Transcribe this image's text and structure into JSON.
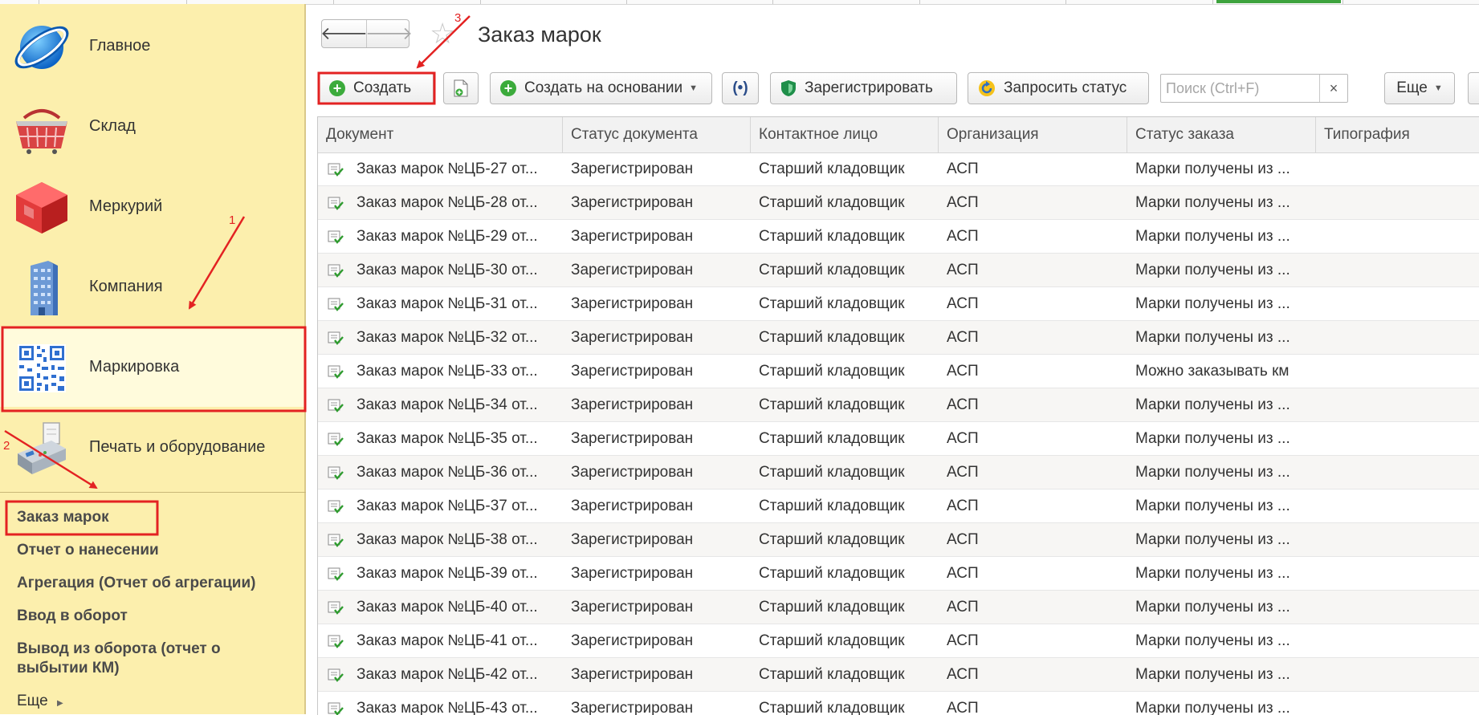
{
  "sidebar": {
    "sections": [
      {
        "label": "Главное",
        "icon": "globe-icon"
      },
      {
        "label": "Склад",
        "icon": "basket-icon"
      },
      {
        "label": "Меркурий",
        "icon": "red-cube-icon"
      },
      {
        "label": "Компания",
        "icon": "building-icon"
      },
      {
        "label": "Маркировка",
        "icon": "qr-code-icon",
        "active": true
      },
      {
        "label": "Печать и оборудование",
        "icon": "printer-icon"
      }
    ],
    "commands": [
      {
        "label": "Заказ марок"
      },
      {
        "label": "Отчет о нанесении"
      },
      {
        "label": "Агрегация (Отчет об агрегации)"
      },
      {
        "label": "Ввод в оборот"
      },
      {
        "label": "Вывод из оборота (отчет о"
      },
      {
        "label": "выбытии КМ)"
      }
    ],
    "more_label": "Еще"
  },
  "header": {
    "back_icon": "arrow-left-icon",
    "forward_icon": "arrow-right-icon",
    "star_icon": "favorite-star-icon",
    "title": "Заказ марок"
  },
  "toolbar": {
    "create_label": "Создать",
    "copy_icon": "copy-document-icon",
    "create_based_label": "Создать на основании",
    "scan_icon": "broadcast-icon",
    "register_label": "Зарегистрировать",
    "request_status_label": "Запросить статус",
    "search_placeholder": "Поиск (Ctrl+F)",
    "clear_glyph": "×",
    "more_label": "Еще"
  },
  "table": {
    "columns": [
      "Документ",
      "Статус документа",
      "Контактное лицо",
      "Организация",
      "Статус заказа",
      "Типография"
    ],
    "rows": [
      [
        "Заказ марок №ЦБ-27 от...",
        "Зарегистрирован",
        "Старший кладовщик",
        "АСП",
        "Марки получены из ...",
        ""
      ],
      [
        "Заказ марок №ЦБ-28 от...",
        "Зарегистрирован",
        "Старший кладовщик",
        "АСП",
        "Марки получены из ...",
        ""
      ],
      [
        "Заказ марок №ЦБ-29 от...",
        "Зарегистрирован",
        "Старший кладовщик",
        "АСП",
        "Марки получены из ...",
        ""
      ],
      [
        "Заказ марок №ЦБ-30 от...",
        "Зарегистрирован",
        "Старший кладовщик",
        "АСП",
        "Марки получены из ...",
        ""
      ],
      [
        "Заказ марок №ЦБ-31 от...",
        "Зарегистрирован",
        "Старший кладовщик",
        "АСП",
        "Марки получены из ...",
        ""
      ],
      [
        "Заказ марок №ЦБ-32 от...",
        "Зарегистрирован",
        "Старший кладовщик",
        "АСП",
        "Марки получены из ...",
        ""
      ],
      [
        "Заказ марок №ЦБ-33 от...",
        "Зарегистрирован",
        "Старший кладовщик",
        "АСП",
        "Можно заказывать км",
        ""
      ],
      [
        "Заказ марок №ЦБ-34 от...",
        "Зарегистрирован",
        "Старший кладовщик",
        "АСП",
        "Марки получены из ...",
        ""
      ],
      [
        "Заказ марок №ЦБ-35 от...",
        "Зарегистрирован",
        "Старший кладовщик",
        "АСП",
        "Марки получены из ...",
        ""
      ],
      [
        "Заказ марок №ЦБ-36 от...",
        "Зарегистрирован",
        "Старший кладовщик",
        "АСП",
        "Марки получены из ...",
        ""
      ],
      [
        "Заказ марок №ЦБ-37 от...",
        "Зарегистрирован",
        "Старший кладовщик",
        "АСП",
        "Марки получены из ...",
        ""
      ],
      [
        "Заказ марок №ЦБ-38 от...",
        "Зарегистрирован",
        "Старший кладовщик",
        "АСП",
        "Марки получены из ...",
        ""
      ],
      [
        "Заказ марок №ЦБ-39 от...",
        "Зарегистрирован",
        "Старший кладовщик",
        "АСП",
        "Марки получены из ...",
        ""
      ],
      [
        "Заказ марок №ЦБ-40 от...",
        "Зарегистрирован",
        "Старший кладовщик",
        "АСП",
        "Марки получены из ...",
        ""
      ],
      [
        "Заказ марок №ЦБ-41 от...",
        "Зарегистрирован",
        "Старший кладовщик",
        "АСП",
        "Марки получены из ...",
        ""
      ],
      [
        "Заказ марок №ЦБ-42 от...",
        "Зарегистрирован",
        "Старший кладовщик",
        "АСП",
        "Марки получены из ...",
        ""
      ],
      [
        "Заказ марок №ЦБ-43 от...",
        "Зарегистрирован",
        "Старший кладовщик",
        "АСП",
        "Марки получены из ...",
        ""
      ]
    ]
  },
  "annotations": {
    "step1": "1",
    "step2": "2",
    "step3": "3",
    "color": "#e32222"
  },
  "colors": {
    "sidebar_bg": "#fcefad",
    "accent_green": "#3cab3c",
    "highlight_red": "#e32222"
  }
}
